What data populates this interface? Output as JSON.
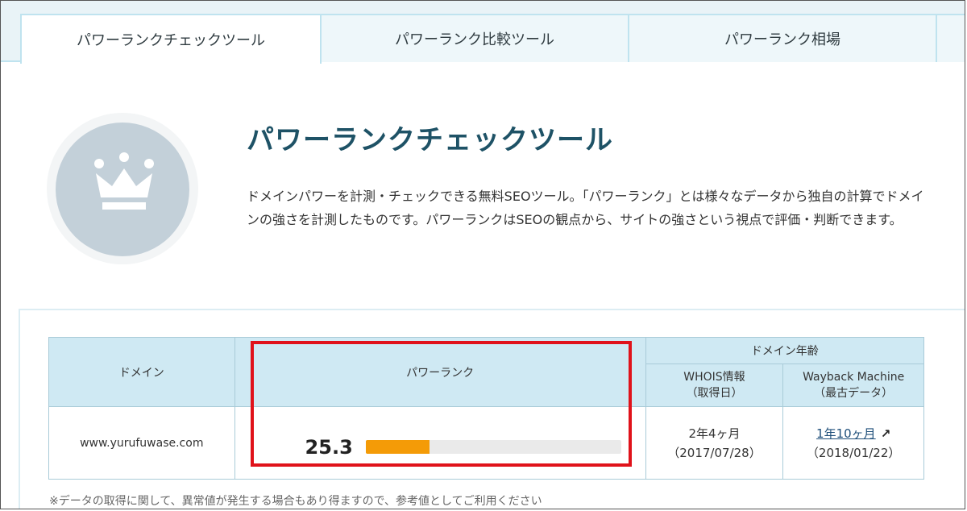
{
  "tabs": [
    {
      "label": "パワーランクチェックツール",
      "active": true
    },
    {
      "label": "パワーランク比較ツール",
      "active": false
    },
    {
      "label": "パワーランク相場",
      "active": false
    }
  ],
  "header": {
    "title": "パワーランクチェックツール",
    "description": "ドメインパワーを計測・チェックできる無料SEOツール。「パワーランク」とは様々なデータから独自の計算でドメインの強さを計測したものです。パワーランクはSEOの観点から、サイトの強さという視点で評価・判断できます。",
    "icon": "crown-icon"
  },
  "table": {
    "headers": {
      "domain": "ドメイン",
      "power_rank": "パワーランク",
      "domain_age": "ドメイン年齢",
      "whois": "WHOIS情報",
      "whois_sub": "（取得日）",
      "wayback": "Wayback Machine",
      "wayback_sub": "（最古データ）"
    },
    "row": {
      "domain": "www.yurufuwase.com",
      "power_rank": "25.3",
      "power_rank_fraction": 0.25,
      "whois_age": "2年4ヶ月",
      "whois_date": "（2017/07/28）",
      "wayback_age": "1年10ヶ月",
      "wayback_date": "（2018/01/22）"
    }
  },
  "note": "※データの取得に関して、異常値が発生する場合もあり得ますので、参考値としてご利用ください",
  "colors": {
    "accent": "#1e5266",
    "bar": "#f49b07",
    "highlight": "#e0121a",
    "header_bg": "#cfe9f3"
  }
}
